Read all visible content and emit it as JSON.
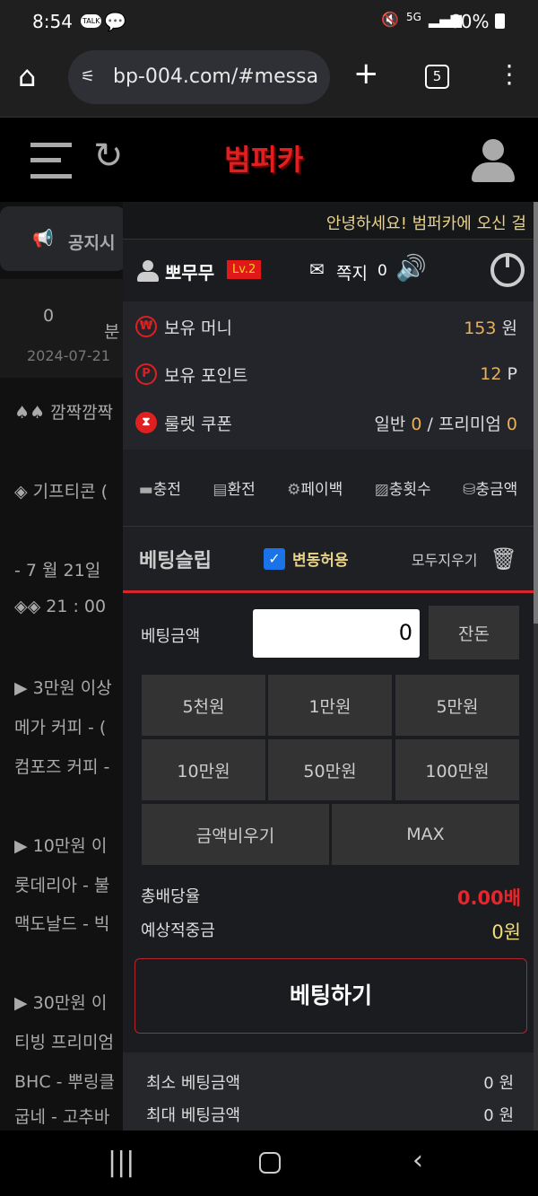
{
  "status": {
    "time": "8:54",
    "notif1": "TALK",
    "battery": "60%",
    "network": "5G"
  },
  "browser": {
    "url": "bp-004.com/#messa",
    "tab_count": "5"
  },
  "site": {
    "logo": "범퍼카"
  },
  "background": {
    "notice_tab": "공지시",
    "count": "0",
    "date": "2024-07-21",
    "sub": "분",
    "lines": [
      "♠♠ 깜짝깜짝",
      "◈ 기프티콘 (",
      "- 7 월 21일",
      "◈◈ 21 : 00",
      "▶ 3만원 이상",
      "메가 커피 - (",
      "컴포즈 커피 -",
      "▶ 10만원 이",
      "롯데리아 - 불",
      "맥도날드 - 빅",
      "▶ 30만원 이",
      "티빙 프리미엄",
      "BHC - 뿌링클",
      "굽네 - 고추바"
    ]
  },
  "drawer": {
    "greeting": "안녕하세요! 범퍼카에 오신 걸",
    "username": "뽀무무",
    "level": "Lv.2",
    "messages_label": "쪽지",
    "messages_count": "0",
    "money_label": "보유 머니",
    "money_value": "153",
    "money_unit": "원",
    "point_label": "보유 포인트",
    "point_value": "12",
    "point_unit": "P",
    "coupon_label": "룰렛 쿠폰",
    "coupon_normal_label": "일반",
    "coupon_normal": "0",
    "coupon_premium_label": "프리미엄",
    "coupon_premium": "0",
    "quick": [
      "충전",
      "환전",
      "페이백",
      "충횟수",
      "충금액"
    ]
  },
  "slip": {
    "title": "베팅슬립",
    "allow_change": "변동허용",
    "allow_checked": true,
    "clear_all": "모두지우기",
    "amount_label": "베팅금액",
    "amount_value": "0",
    "balance_btn": "잔돈",
    "chips": [
      "5천원",
      "1만원",
      "5만원",
      "10만원",
      "50만원",
      "100만원"
    ],
    "clear_amount": "금액비우기",
    "max": "MAX",
    "total_odds_label": "총배당율",
    "total_odds": "0.00배",
    "expected_label": "예상적중금",
    "expected": "0원",
    "bet_button": "베팅하기",
    "min_label": "최소 베팅금액",
    "min_value": "0 원",
    "max_label": "최대 베팅금액",
    "max_value": "0 원"
  },
  "colors": {
    "accent_red": "#d8242c",
    "gold": "#e8b05a",
    "checkbox": "#1a73e8"
  }
}
